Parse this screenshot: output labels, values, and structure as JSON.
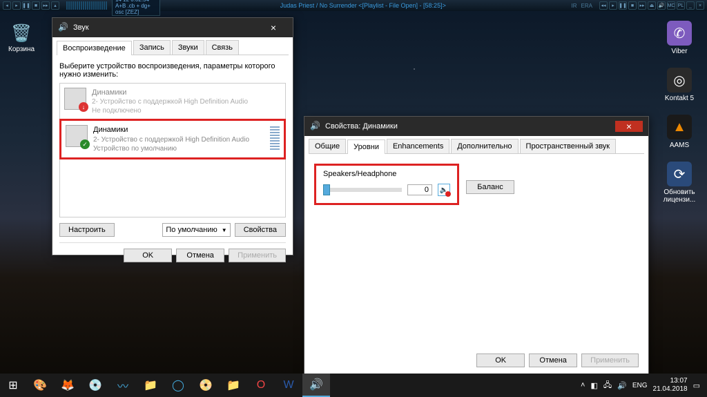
{
  "player": {
    "time_info": "14   12   0.02.54   A+B .cb + dg+  osc  [ZEZ]",
    "track": "Judas Priest / No Surrender   <[Playlist - File Open] - [58:25]>",
    "kbps": "",
    "ir_label": "IR",
    "era_label": "ERA"
  },
  "recycle": {
    "label": "Корзина"
  },
  "desktop_icons": [
    {
      "label": "Viber",
      "bg": "#7d5bbe",
      "glyph": "✆"
    },
    {
      "label": "Kontakt 5",
      "bg": "#2a2a2a",
      "glyph": "◎"
    },
    {
      "label": "AAMS",
      "bg": "#1a1a1a",
      "glyph": "▲"
    },
    {
      "label": "Обновить лицензи...",
      "bg": "#2a4a7a",
      "glyph": "⟳"
    }
  ],
  "sound_dialog": {
    "title": "Звук",
    "tabs": [
      "Воспроизведение",
      "Запись",
      "Звуки",
      "Связь"
    ],
    "active_tab": 0,
    "instruction": "Выберите устройство воспроизведения, параметры которого нужно изменить:",
    "devices": [
      {
        "name": "Динамики",
        "desc": "2- Устройство с поддержкой High Definition Audio",
        "status": "Не подключено",
        "disabled": true,
        "badge_color": "#d33",
        "badge_glyph": "↓"
      },
      {
        "name": "Динамики",
        "desc": "2- Устройство с поддержкой High Definition Audio",
        "status": "Устройство по умолчанию",
        "disabled": false,
        "badge_color": "#2a8a2a",
        "badge_glyph": "✓",
        "highlighted": true
      }
    ],
    "btn_configure": "Настроить",
    "dropdown_default": "По умолчанию",
    "btn_properties": "Свойства",
    "btn_ok": "OK",
    "btn_cancel": "Отмена",
    "btn_apply": "Применить"
  },
  "props_dialog": {
    "title": "Свойства: Динамики",
    "tabs": [
      "Общие",
      "Уровни",
      "Enhancements",
      "Дополнительно",
      "Пространственный звук"
    ],
    "active_tab": 1,
    "channel_label": "Speakers/Headphone",
    "level_value": "0",
    "btn_balance": "Баланс",
    "btn_ok": "OK",
    "btn_cancel": "Отмена",
    "btn_apply": "Применить"
  },
  "taskbar": {
    "lang": "ENG",
    "time": "13:07",
    "date": "21.04.2018"
  }
}
